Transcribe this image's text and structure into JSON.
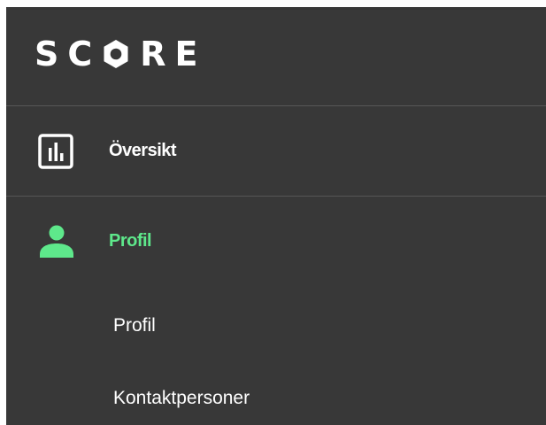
{
  "brand": {
    "logo_text_before": "SC",
    "logo_text_after": "RE"
  },
  "nav": {
    "items": [
      {
        "label": "Översikt",
        "icon": "bar-chart-icon",
        "active": false
      },
      {
        "label": "Profil",
        "icon": "user-icon",
        "active": true
      }
    ],
    "subitems": [
      {
        "label": "Profil"
      },
      {
        "label": "Kontaktpersoner"
      }
    ]
  },
  "colors": {
    "sidebar_bg": "#383838",
    "accent": "#5ee88b",
    "divider": "#565656",
    "text": "#ffffff"
  }
}
